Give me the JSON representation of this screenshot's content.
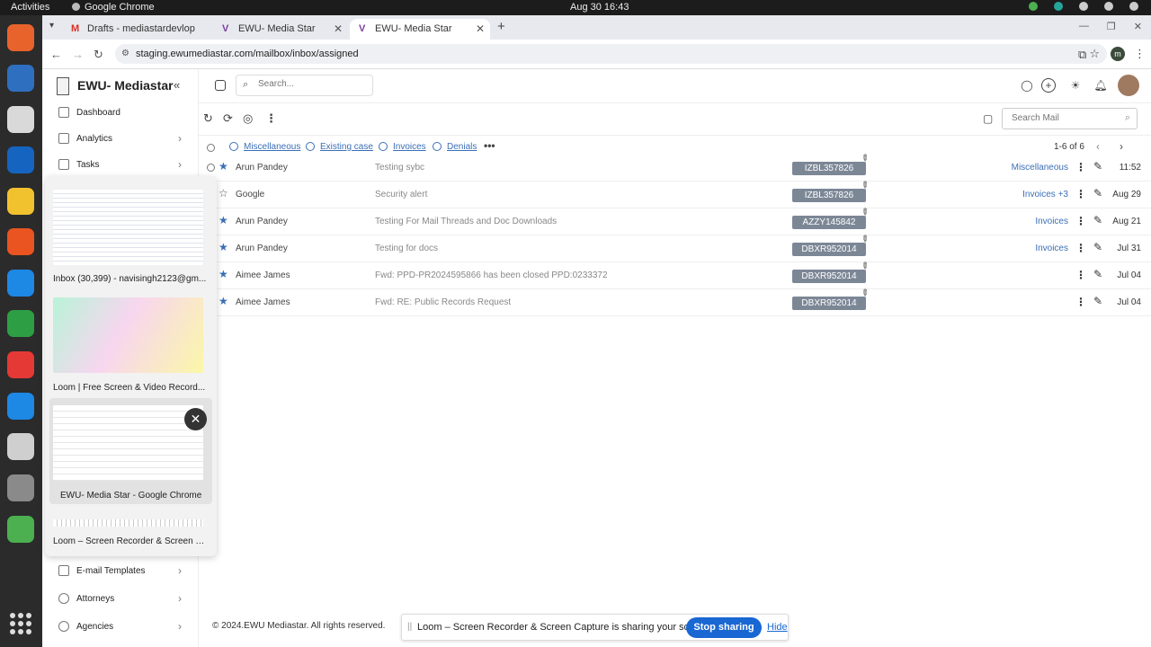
{
  "os": {
    "activities": "Activities",
    "app_name": "Google Chrome",
    "clock": "Aug 30  16:43"
  },
  "browser": {
    "tabs": [
      {
        "label": "Drafts - mediastardevlop",
        "icon": "gmail-icon"
      },
      {
        "label": "EWU- Media Star",
        "icon": "ewu-logo-icon"
      },
      {
        "label": "EWU- Media Star",
        "icon": "ewu-logo-icon"
      }
    ],
    "url": "staging.ewumediastar.com/mailbox/inbox/assigned",
    "profile_initial": "m"
  },
  "sidebar": {
    "brand": "EWU- Mediastar",
    "items": [
      {
        "label": "Dashboard"
      },
      {
        "label": "Analytics"
      },
      {
        "label": "Tasks"
      },
      {
        "label": "E-mail Templates"
      },
      {
        "label": "Attorneys"
      },
      {
        "label": "Agencies"
      }
    ]
  },
  "switcher": {
    "windows": [
      {
        "label": "Inbox (30,399) - navisingh2123@gm..."
      },
      {
        "label": "Loom | Free Screen & Video Record..."
      },
      {
        "label": "EWU- Media Star - Google Chrome"
      },
      {
        "label": "Loom – Screen Recorder & Screen C..."
      }
    ]
  },
  "header": {
    "search_placeholder": "Search...",
    "search_mail_placeholder": "Search Mail"
  },
  "filters": {
    "items": [
      "Miscellaneous",
      "Existing case",
      "Invoices",
      "Denials"
    ],
    "count": "1-6 of 6"
  },
  "emails": [
    {
      "from": "Arun Pandey",
      "subject": "Testing sybc",
      "tag": "IZBL357826",
      "category": "Miscellaneous",
      "date": "11:52",
      "starred": true
    },
    {
      "from": "Google",
      "subject": "Security alert",
      "tag": "IZBL357826",
      "category": "Invoices +3",
      "date": "Aug 29",
      "starred": false
    },
    {
      "from": "Arun Pandey",
      "subject": "Testing For Mail Threads and Doc Downloads",
      "tag": "AZZY145842",
      "category": "Invoices",
      "date": "Aug 21",
      "starred": true
    },
    {
      "from": "Arun Pandey",
      "subject": "Testing for docs",
      "tag": "DBXR952014",
      "category": "Invoices",
      "date": "Jul 31",
      "starred": true
    },
    {
      "from": "Aimee James",
      "subject": "Fwd: PPD-PR2024595866  has been closed PPD:0233372",
      "tag": "DBXR952014",
      "category": "",
      "date": "Jul 04",
      "starred": true
    },
    {
      "from": "Aimee James",
      "subject": "Fwd: RE: Public Records Request",
      "tag": "DBXR952014",
      "category": "",
      "date": "Jul 04",
      "starred": true
    }
  ],
  "footer": "© 2024.EWU Mediastar. All rights reserved.",
  "share_bar": {
    "message": "Loom – Screen Recorder & Screen Capture is sharing your screen.",
    "stop_label": "Stop sharing",
    "hide_label": "Hide"
  },
  "colors": {
    "accent": "#3b6fb6",
    "tag_bg": "#7c8796",
    "share_button": "#1967d2"
  }
}
